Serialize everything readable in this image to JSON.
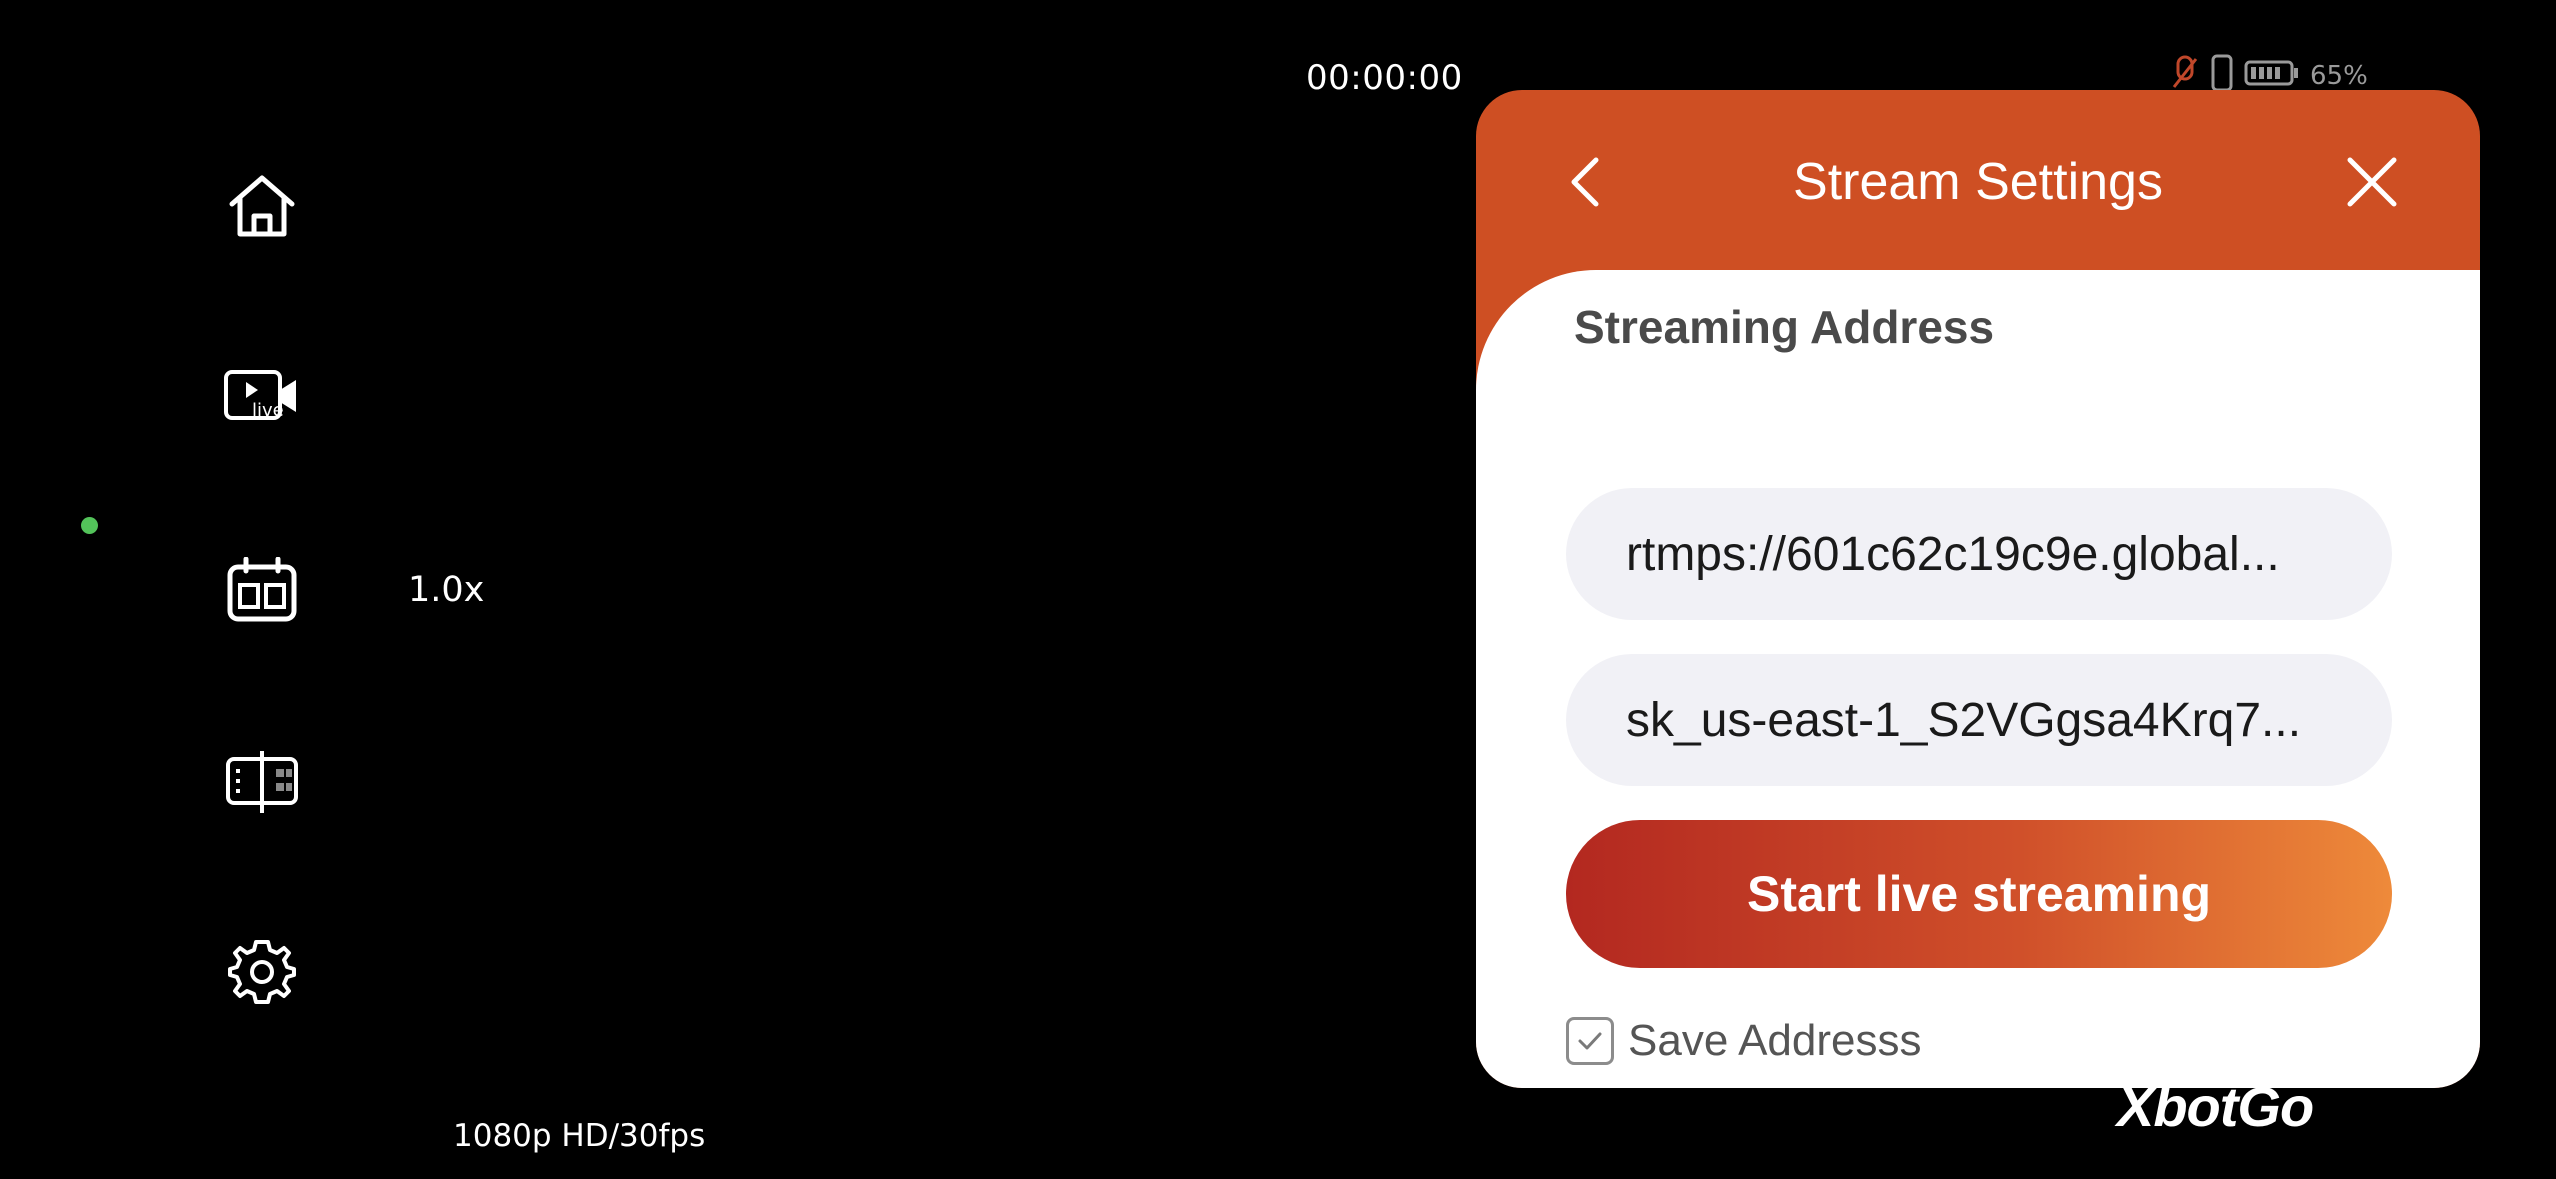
{
  "recording": {
    "timer": "00:00:00",
    "zoom": "1.0x",
    "quality": "1080p HD/30fps"
  },
  "status_bar": {
    "battery": "65%"
  },
  "sidebar": {
    "items": [
      {
        "icon": "home-icon"
      },
      {
        "icon": "live-video-icon",
        "label": "live"
      },
      {
        "icon": "scene-layout-icon"
      },
      {
        "icon": "split-frame-icon"
      },
      {
        "icon": "gear-icon"
      }
    ]
  },
  "stream_settings": {
    "title": "Stream Settings",
    "section_label": "Streaming Address",
    "server_url": "rtmps://601c62c19c9e.global...",
    "stream_key": "sk_us-east-1_S2VGgsa4Krq7...",
    "start_button": "Start live streaming",
    "save_label": "Save Addresss",
    "save_checked": true
  },
  "brand": {
    "logo_text": "XbotGo"
  },
  "colors": {
    "background": "#000000",
    "panel_header": "#ce4f23",
    "button_start": "#b32820",
    "button_end": "#ee8a3a",
    "recording_dot": "#53c35a"
  }
}
